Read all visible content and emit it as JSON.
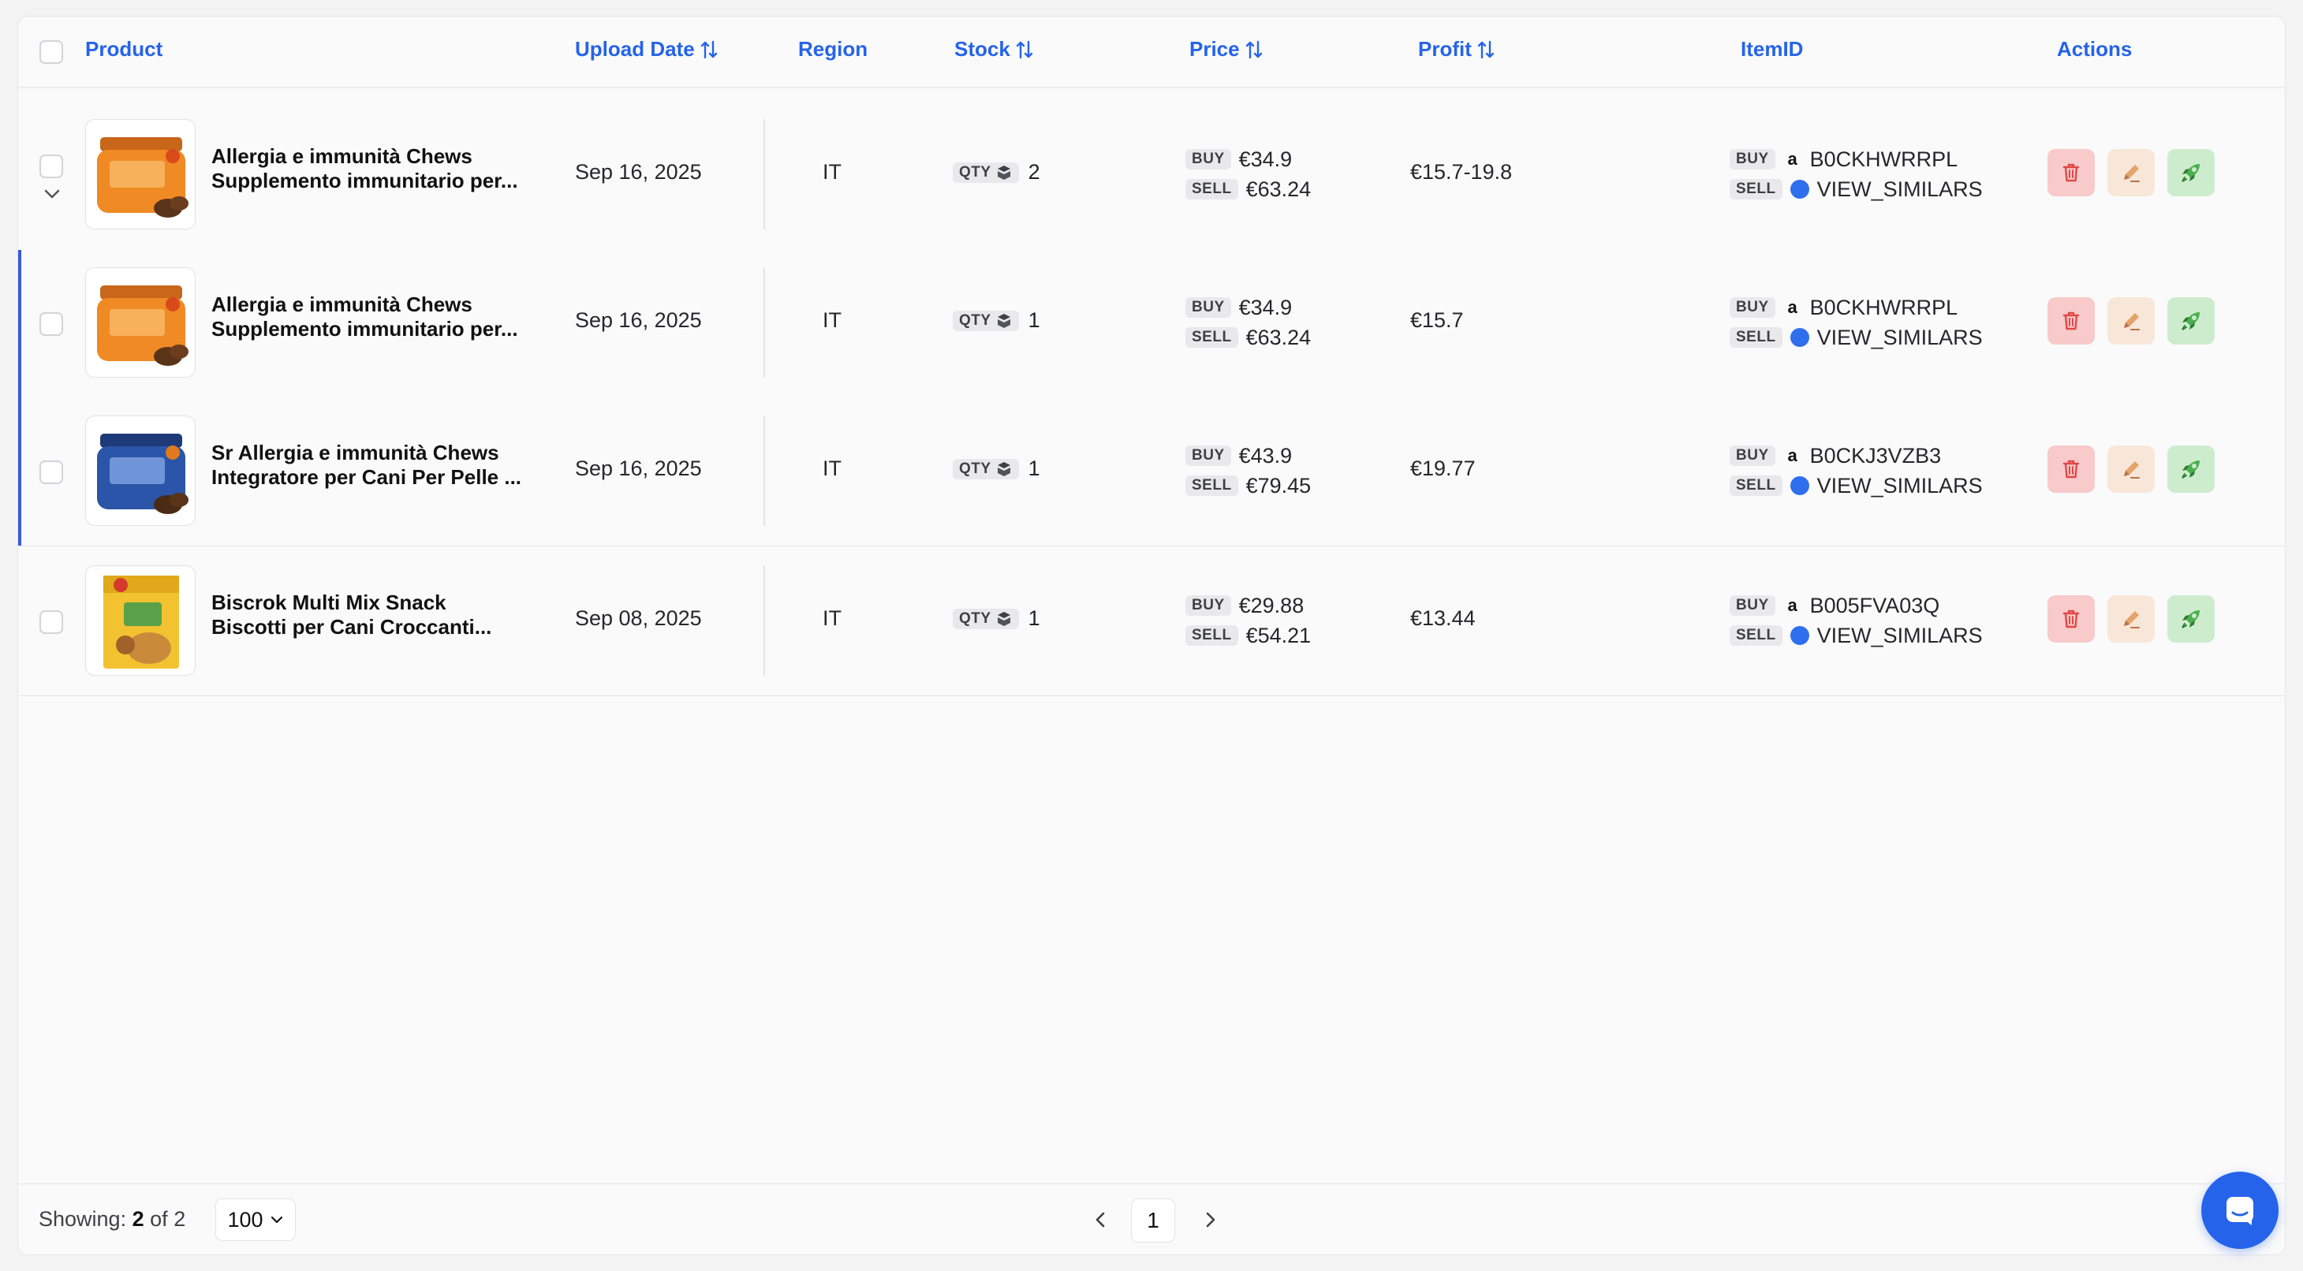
{
  "header": {
    "product": "Product",
    "upload_date": "Upload Date",
    "region": "Region",
    "stock": "Stock",
    "price": "Price",
    "profit": "Profit",
    "item_id": "ItemID",
    "actions": "Actions"
  },
  "labels": {
    "qty": "QTY",
    "buy": "BUY",
    "sell": "SELL"
  },
  "rows": [
    {
      "name_line1": "Allergia e immunità Chews",
      "name_line2": "Supplemento immunitario per...",
      "date": "Sep 16, 2025",
      "region": "IT",
      "qty": "2",
      "buy_price": "€34.9",
      "sell_price": "€63.24",
      "profit": "€15.7-19.8",
      "buy_id": "B0CKHWRRPL",
      "sell_id": "VIEW_SIMILARS"
    },
    {
      "name_line1": "Allergia e immunità Chews",
      "name_line2": "Supplemento immunitario per...",
      "date": "Sep 16, 2025",
      "region": "IT",
      "qty": "1",
      "buy_price": "€34.9",
      "sell_price": "€63.24",
      "profit": "€15.7",
      "buy_id": "B0CKHWRRPL",
      "sell_id": "VIEW_SIMILARS"
    },
    {
      "name_line1": "Sr Allergia e immunità Chews",
      "name_line2": "Integratore per Cani Per Pelle ...",
      "date": "Sep 16, 2025",
      "region": "IT",
      "qty": "1",
      "buy_price": "€43.9",
      "sell_price": "€79.45",
      "profit": "€19.77",
      "buy_id": "B0CKJ3VZB3",
      "sell_id": "VIEW_SIMILARS"
    },
    {
      "name_line1": "Biscrok Multi Mix Snack",
      "name_line2": "Biscotti per Cani Croccanti...",
      "date": "Sep 08, 2025",
      "region": "IT",
      "qty": "1",
      "buy_price": "€29.88",
      "sell_price": "€54.21",
      "profit": "€13.44",
      "buy_id": "B005FVA03Q",
      "sell_id": "VIEW_SIMILARS"
    }
  ],
  "footer": {
    "showing_label": "Showing:",
    "showing_count": "2",
    "of_label": "of",
    "total": "2",
    "page_size": "100",
    "current_page": "1"
  },
  "icons": {
    "sort": "sort-arrows-icon",
    "expand": "chevron-down-icon",
    "stock": "box-icon",
    "amazon": "amazon-icon",
    "marketplace": "marketplace-dot-icon",
    "delete": "trash-icon",
    "edit": "pencil-icon",
    "launch": "rocket-icon",
    "chat": "chat-icon"
  },
  "colors": {
    "accent": "#2563eb",
    "delete_bg": "#f8caca",
    "edit_bg": "#f8e7d8",
    "launch_bg": "#cdeccd"
  }
}
